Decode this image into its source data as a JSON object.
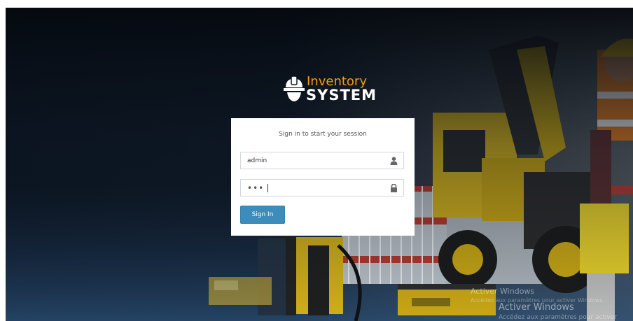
{
  "logo": {
    "line1": "Inventory",
    "line2": "SYSTEM",
    "icon": "hardhat-icon",
    "colors": {
      "line1": "#f39c12",
      "line2": "#ffffff"
    }
  },
  "login": {
    "message": "Sign in to start your session",
    "username": {
      "value": "admin",
      "icon": "user-icon"
    },
    "password": {
      "value": "•••",
      "icon": "lock-icon"
    },
    "submit_label": "Sign In",
    "colors": {
      "button": "#3c8dbc",
      "box": "#ffffff"
    }
  },
  "watermark": {
    "line1": "Activer Windows",
    "line2": "Accédez aux paramètres pour activer Windows.",
    "line3": "Activer Windows",
    "line4": "Accédez aux paramètres pour activer"
  }
}
